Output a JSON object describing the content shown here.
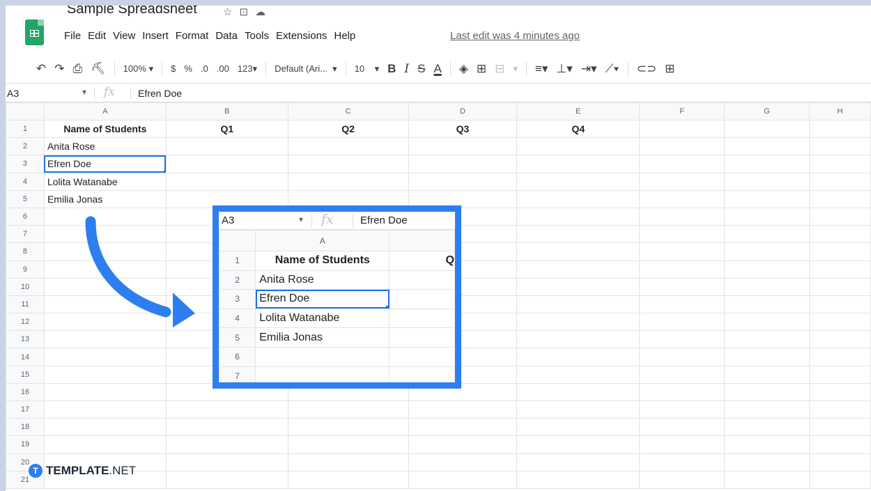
{
  "app": {
    "title": "Sample Spreadsheet",
    "last_edit": "Last edit was 4 minutes ago"
  },
  "menu": [
    "File",
    "Edit",
    "View",
    "Insert",
    "Format",
    "Data",
    "Tools",
    "Extensions",
    "Help"
  ],
  "toolbar": {
    "zoom": "100%",
    "currency": "$",
    "percent": "%",
    "decrease_decimal": ".0",
    "increase_decimal": ".00",
    "more_formats": "123",
    "font": "Default (Ari...",
    "font_size": "10",
    "bold": "B",
    "italic": "I",
    "strikethrough": "S",
    "text_color": "A"
  },
  "formula_bar": {
    "cell_ref": "A3",
    "fx": "fx",
    "value": "Efren Doe"
  },
  "sheet": {
    "columns": [
      "A",
      "B",
      "C",
      "D",
      "E",
      "F",
      "G",
      "H"
    ],
    "rows": [
      [
        "Name of Students",
        "Q1",
        "Q2",
        "Q3",
        "Q4",
        "",
        "",
        ""
      ],
      [
        "Anita Rose",
        "",
        "",
        "",
        "",
        "",
        "",
        ""
      ],
      [
        "Efren Doe",
        "",
        "",
        "",
        "",
        "",
        "",
        ""
      ],
      [
        "Lolita Watanabe",
        "",
        "",
        "",
        "",
        "",
        "",
        ""
      ],
      [
        "Emilia Jonas",
        "",
        "",
        "",
        "",
        "",
        "",
        ""
      ]
    ],
    "row_numbers": [
      "1",
      "2",
      "3",
      "4",
      "5",
      "6",
      "7",
      "8",
      "9",
      "10",
      "11",
      "12",
      "13",
      "14",
      "15",
      "16",
      "17",
      "18",
      "19",
      "20",
      "21"
    ],
    "selected_row": 3
  },
  "zoom_panel": {
    "cell_ref": "A3",
    "fx": "fx",
    "value": "Efren Doe",
    "col_header": "A",
    "row_numbers": [
      "1",
      "2",
      "3",
      "4",
      "5",
      "6",
      "7"
    ],
    "cells": [
      "Name of Students",
      "Anita Rose",
      "Efren Doe",
      "Lolita Watanabe",
      "Emilia Jonas",
      "",
      ""
    ],
    "cut_off_glyph": "Q"
  },
  "watermark": {
    "brand_bold": "TEMPLATE",
    "brand_rest": ".NET",
    "logo_letter": "T"
  },
  "colors": {
    "accent": "#2d7ff0",
    "selection": "#1a73e8",
    "sheets_green": "#23a566"
  }
}
